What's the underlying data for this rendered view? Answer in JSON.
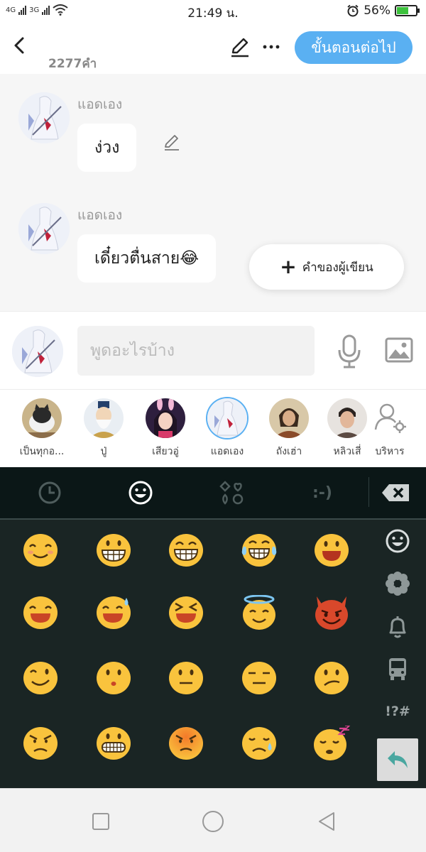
{
  "status_bar": {
    "network_1": "4G",
    "network_2": "3G",
    "time": "21:49 น.",
    "battery_percent": "56%",
    "battery_level": 0.56
  },
  "header": {
    "word_count": "2277คำ",
    "next_button": "ขั้นตอนต่อไป"
  },
  "messages": [
    {
      "sender": "แอดเอง",
      "text": "ง่วง"
    },
    {
      "sender": "แอดเอง",
      "text": "เดี๋ยวตื่นสาย😂"
    }
  ],
  "author_word_button": "คำของผู้เขียน",
  "compose": {
    "placeholder": "พูดอะไรบ้าง"
  },
  "characters": [
    {
      "name": "เป็นทุกอ..."
    },
    {
      "name": "ปู่"
    },
    {
      "name": "เสียวอู่"
    },
    {
      "name": "แอดเอง",
      "selected": true
    },
    {
      "name": "ถังเฮ่า"
    },
    {
      "name": "หลิวเสี่"
    },
    {
      "name": "บริหาร"
    }
  ],
  "keyboard": {
    "tabs": [
      "clock-icon",
      "smiley-icon",
      "symbols-icon",
      "emoticon"
    ],
    "emoticon_label": ":-)",
    "side_symbols_label": "!?#",
    "side_icons": [
      "smiley-icon",
      "flower-icon",
      "bell-icon",
      "bus-icon"
    ],
    "emoji_rows": [
      [
        "smiling-face",
        "grinning-face",
        "grinning-smiling-eyes",
        "tears-of-joy",
        "smiley-face"
      ],
      [
        "smile-open",
        "sweat-smile",
        "squinting-face",
        "halo-face",
        "smiling-devil"
      ],
      [
        "winking-face",
        "kissing-face",
        "neutral-face",
        "expressionless-face",
        "confused-face"
      ],
      [
        "angry-face",
        "grimacing-face",
        "pouting-face",
        "disappointed-relieved",
        "sleeping-face"
      ]
    ]
  },
  "colors": {
    "accent": "#5ab0f2",
    "keyboard_bg": "#1a2524",
    "emoji_yellow": "#f9c33d",
    "devil_red": "#d9482b"
  }
}
